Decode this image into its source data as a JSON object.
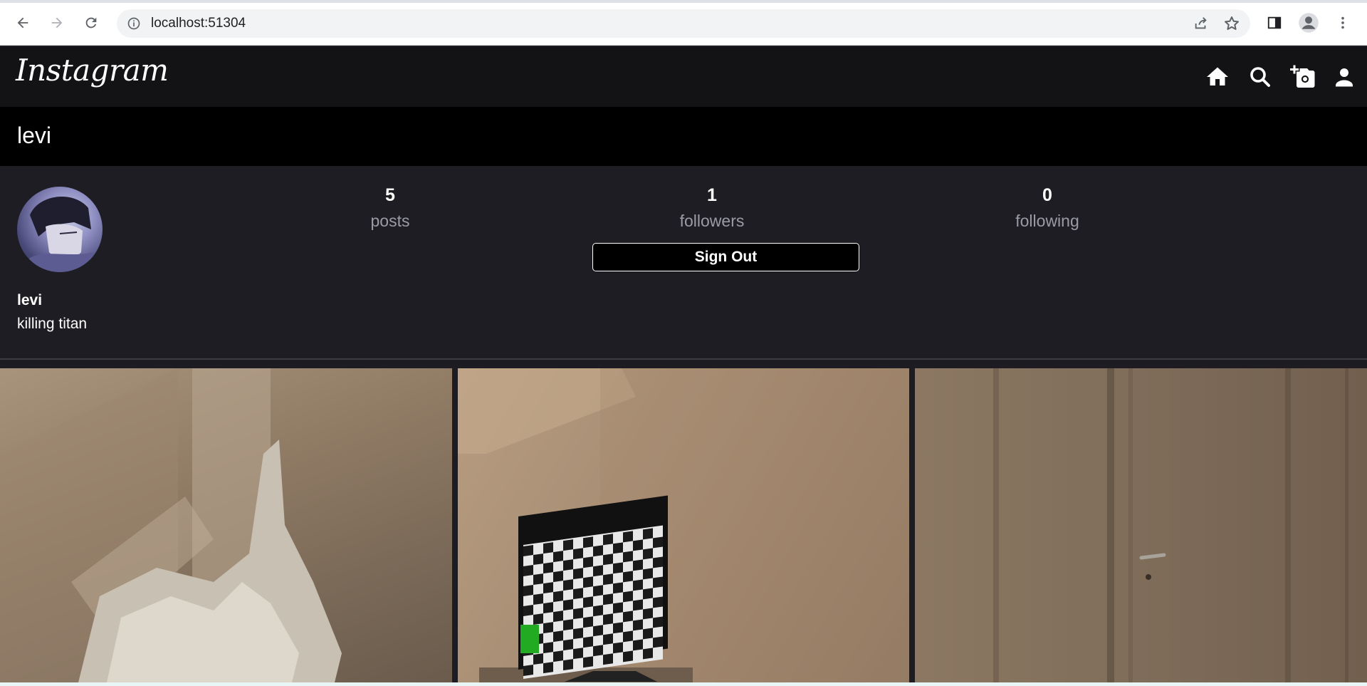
{
  "browser": {
    "url": "localhost:51304",
    "icons": [
      "back-icon",
      "forward-icon",
      "reload-icon",
      "info-icon",
      "share-icon",
      "star-icon",
      "side-panel-icon",
      "profile-icon",
      "menu-icon"
    ]
  },
  "app": {
    "logo": "Instagram",
    "nav_icons": [
      "home-icon",
      "search-icon",
      "add-photo-icon",
      "profile-icon"
    ]
  },
  "profile": {
    "username": "levi",
    "stats": [
      {
        "value": "5",
        "label": "posts"
      },
      {
        "value": "1",
        "label": "followers"
      },
      {
        "value": "0",
        "label": "following"
      }
    ],
    "signout_label": "Sign Out",
    "display_name": "levi",
    "bio": "killing titan"
  },
  "colors": {
    "header_bg": "#131315",
    "username_bar_bg": "#000000",
    "profile_bg": "#1d1d23",
    "accent_green": "#22aa22"
  }
}
